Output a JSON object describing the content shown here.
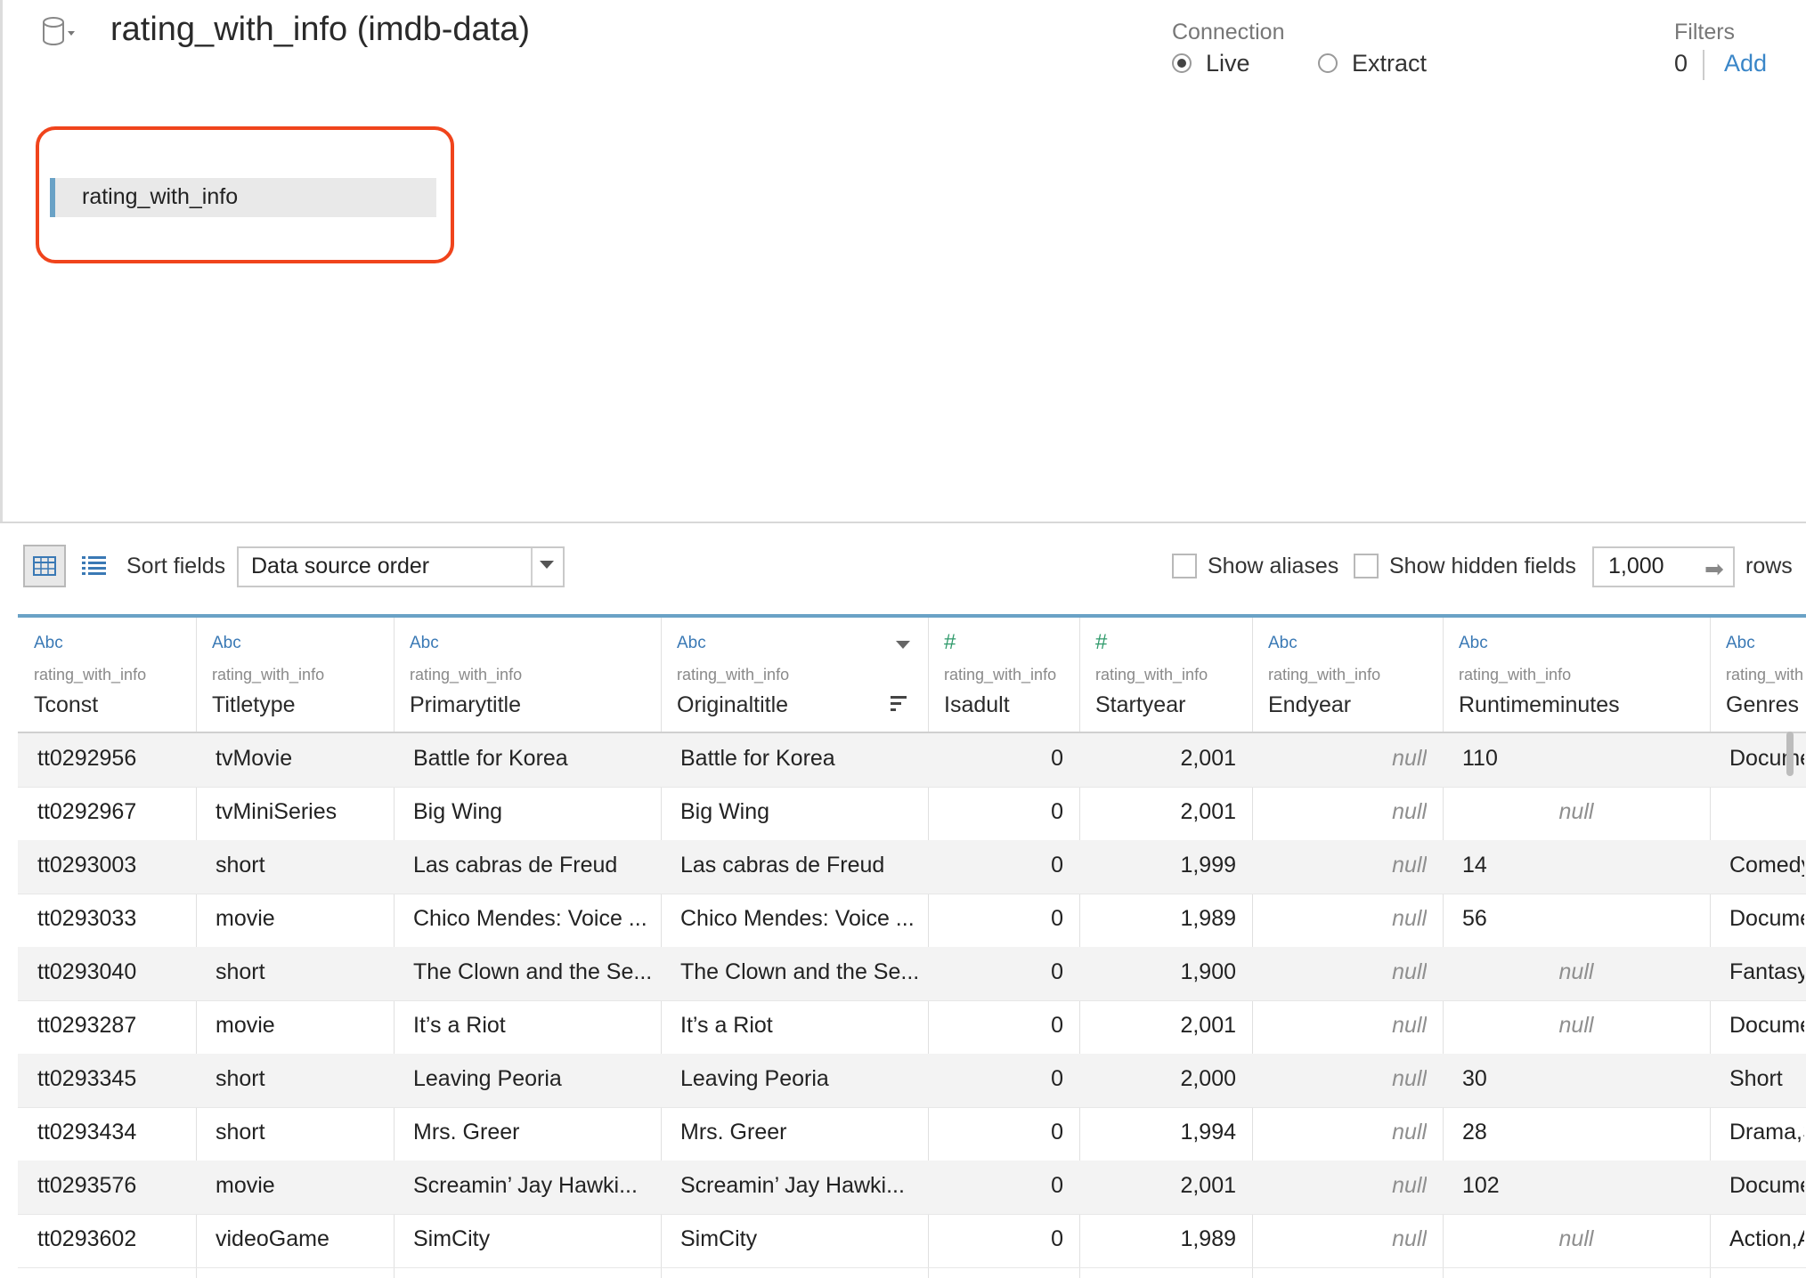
{
  "header": {
    "title": "rating_with_info (imdb-data)",
    "connection": {
      "label": "Connection",
      "options": [
        "Live",
        "Extract"
      ],
      "selected": "Live"
    },
    "filters": {
      "label": "Filters",
      "count": "0",
      "add": "Add"
    }
  },
  "canvas": {
    "table_name": "rating_with_info"
  },
  "toolbar": {
    "sort_label": "Sort fields",
    "sort_value": "Data source order",
    "show_aliases": "Show aliases",
    "show_hidden": "Show hidden fields",
    "rows_value": "1,000",
    "rows_label": "rows"
  },
  "grid": {
    "columns": [
      {
        "type": "Abc",
        "source": "rating_with_info",
        "name": "Tconst"
      },
      {
        "type": "Abc",
        "source": "rating_with_info",
        "name": "Titletype"
      },
      {
        "type": "Abc",
        "source": "rating_with_info",
        "name": "Primarytitle"
      },
      {
        "type": "Abc",
        "source": "rating_with_info",
        "name": "Originaltitle"
      },
      {
        "type": "#",
        "source": "rating_with_info",
        "name": "Isadult"
      },
      {
        "type": "#",
        "source": "rating_with_info",
        "name": "Startyear"
      },
      {
        "type": "Abc",
        "source": "rating_with_info",
        "name": "Endyear"
      },
      {
        "type": "Abc",
        "source": "rating_with_info",
        "name": "Runtimeminutes"
      },
      {
        "type": "Abc",
        "source": "rating_with",
        "name": "Genres"
      }
    ],
    "rows": [
      [
        "tt0292956",
        "tvMovie",
        "Battle for Korea",
        "Battle for Korea",
        "0",
        "2,001",
        "null",
        "110",
        "Docume"
      ],
      [
        "tt0292967",
        "tvMiniSeries",
        "Big Wing",
        "Big Wing",
        "0",
        "2,001",
        "null",
        "null",
        ""
      ],
      [
        "tt0293003",
        "short",
        "Las cabras de Freud",
        "Las cabras de Freud",
        "0",
        "1,999",
        "null",
        "14",
        "Comedy"
      ],
      [
        "tt0293033",
        "movie",
        "Chico Mendes: Voice ...",
        "Chico Mendes: Voice ...",
        "0",
        "1,989",
        "null",
        "56",
        "Docume"
      ],
      [
        "tt0293040",
        "short",
        "The Clown and the Se...",
        "The Clown and the Se...",
        "0",
        "1,900",
        "null",
        "null",
        "Fantasy"
      ],
      [
        "tt0293287",
        "movie",
        "It’s a Riot",
        "It’s a Riot",
        "0",
        "2,001",
        "null",
        "null",
        "Docume"
      ],
      [
        "tt0293345",
        "short",
        "Leaving Peoria",
        "Leaving Peoria",
        "0",
        "2,000",
        "null",
        "30",
        "Short"
      ],
      [
        "tt0293434",
        "short",
        "Mrs. Greer",
        "Mrs. Greer",
        "0",
        "1,994",
        "null",
        "28",
        "Drama,S"
      ],
      [
        "tt0293576",
        "movie",
        "Screamin’ Jay Hawki...",
        "Screamin’ Jay Hawki...",
        "0",
        "2,001",
        "null",
        "102",
        "Docume"
      ],
      [
        "tt0293602",
        "videoGame",
        "SimCity",
        "SimCity",
        "0",
        "1,989",
        "null",
        "null",
        "Action,A"
      ]
    ]
  }
}
